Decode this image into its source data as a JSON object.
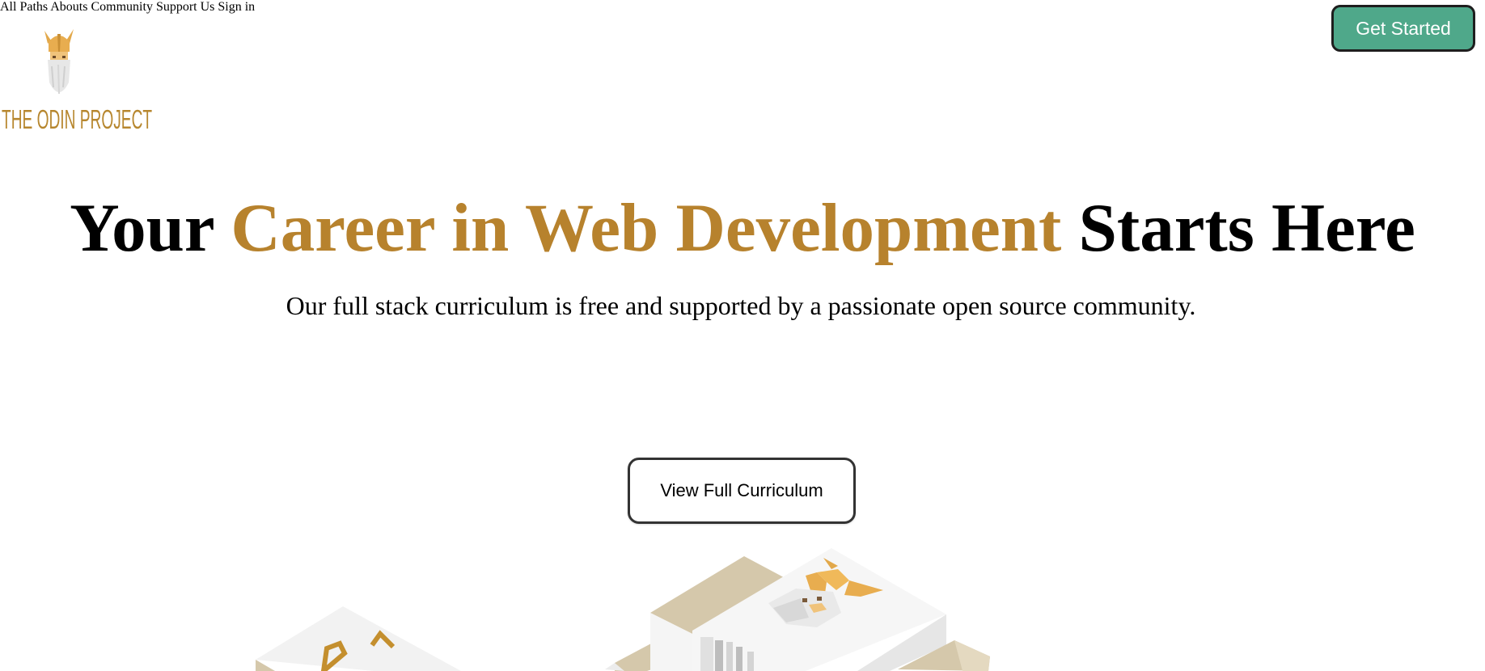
{
  "brand": {
    "wordmark": "THE ODIN PROJECT",
    "icon": "odin-viking-icon",
    "color": "#b7872f"
  },
  "nav": {
    "items": [
      {
        "label": "All Paths"
      },
      {
        "label": "Abouts"
      },
      {
        "label": "Community"
      },
      {
        "label": "Support Us"
      },
      {
        "label": "Sign in"
      }
    ],
    "cta_label": "Get Started"
  },
  "hero": {
    "title_start": "Your ",
    "title_accent": "Career in Web Development",
    "title_end": " Starts Here",
    "subtitle": "Our full stack curriculum is free and supported by a passionate open source community.",
    "button_label": "View Full Curriculum"
  },
  "colors": {
    "accent": "#b7822d",
    "cta_bg": "#4fa88a",
    "nav_text": "#767676"
  }
}
